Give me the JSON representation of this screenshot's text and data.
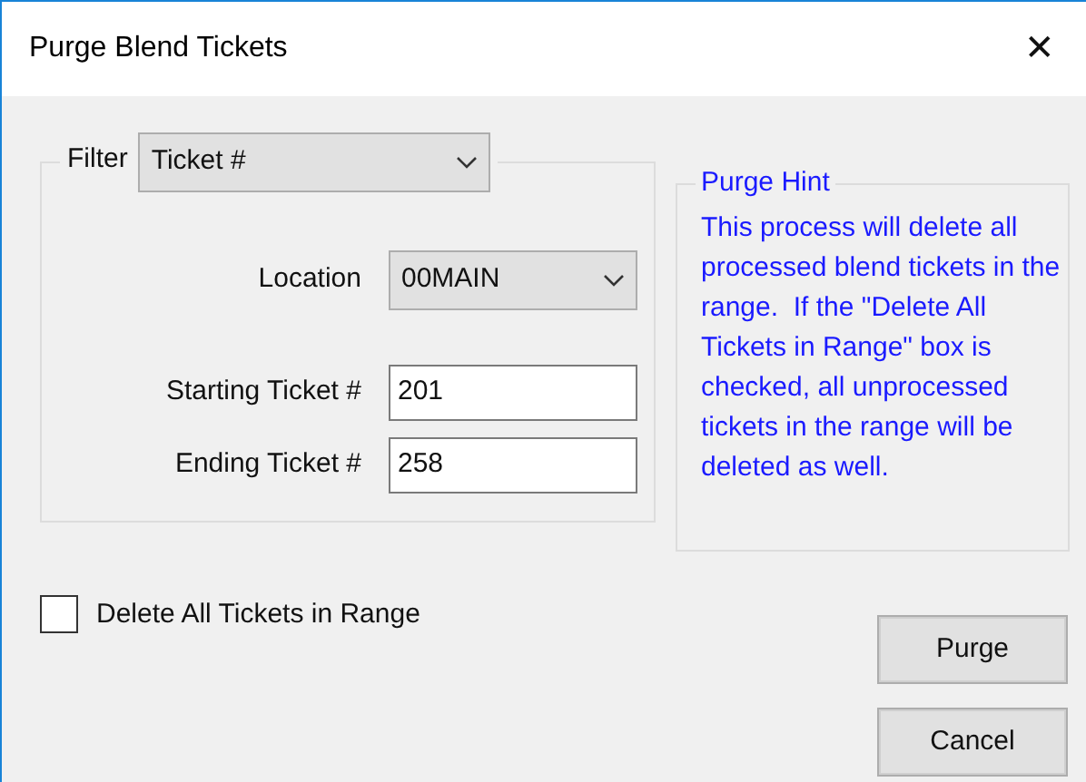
{
  "window": {
    "title": "Purge Blend Tickets",
    "close": "✕"
  },
  "filter": {
    "label": "Filter",
    "value": "Ticket #"
  },
  "fields": [
    {
      "kind": "dropdown",
      "label": "Location",
      "value": "00MAIN"
    },
    {
      "kind": "text",
      "label": "Starting Ticket #",
      "value": "201"
    },
    {
      "kind": "text",
      "label": "Ending Ticket #",
      "value": "258"
    }
  ],
  "hint": {
    "title": "Purge Hint",
    "text": "This process will delete all processed blend tickets in the range.  If the \"Delete All Tickets in Range\" box is checked, all unprocessed tickets in the range will be deleted as well."
  },
  "checkbox": {
    "label": "Delete All Tickets in Range",
    "checked": false
  },
  "buttons": [
    "Purge",
    "Cancel"
  ]
}
